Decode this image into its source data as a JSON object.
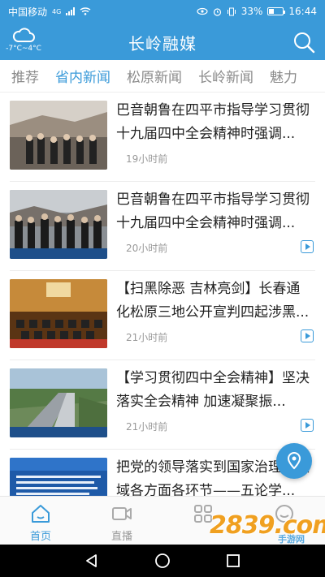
{
  "status_bar": {
    "carrier": "中国移动",
    "network": "4G",
    "battery": "33%",
    "time": "16:44"
  },
  "header": {
    "weather_temp": "-7°C~4°C",
    "title": "长岭融媒",
    "weather_icon": "cloud-icon",
    "search_icon": "search-icon"
  },
  "tabs": [
    {
      "label": "推荐",
      "active": false
    },
    {
      "label": "省内新闻",
      "active": true
    },
    {
      "label": "松原新闻",
      "active": false
    },
    {
      "label": "长岭新闻",
      "active": false
    },
    {
      "label": "魅力",
      "active": false
    }
  ],
  "news": [
    {
      "title": "巴音朝鲁在四平市指导学习贯彻十九届四中全会精神时强调...",
      "time": "19小时前",
      "video": false
    },
    {
      "title": "巴音朝鲁在四平市指导学习贯彻十九届四中全会精神时强调...",
      "time": "20小时前",
      "video": true
    },
    {
      "title": "【扫黑除恶 吉林亮剑】长春通化松原三地公开宣判四起涉黑...",
      "time": "21小时前",
      "video": true
    },
    {
      "title": "【学习贯彻四中全会精神】坚决落实全会精神 加速凝聚振...",
      "time": "21小时前",
      "video": true
    },
    {
      "title": "把党的领导落实到国家治理各领域各方面各环节——五论学...",
      "time": "",
      "video": false
    }
  ],
  "bottom_nav": [
    {
      "label": "首页",
      "icon": "home-icon",
      "active": true
    },
    {
      "label": "直播",
      "icon": "video-camera-icon",
      "active": false
    },
    {
      "label": "",
      "icon": "grid-icon",
      "active": false
    },
    {
      "label": "",
      "icon": "smiley-icon",
      "active": false
    }
  ],
  "watermark": {
    "logo": "2839.com",
    "sub": "手游网"
  },
  "colors": {
    "brand": "#3a9ad9",
    "text": "#222222",
    "muted": "#999999"
  }
}
